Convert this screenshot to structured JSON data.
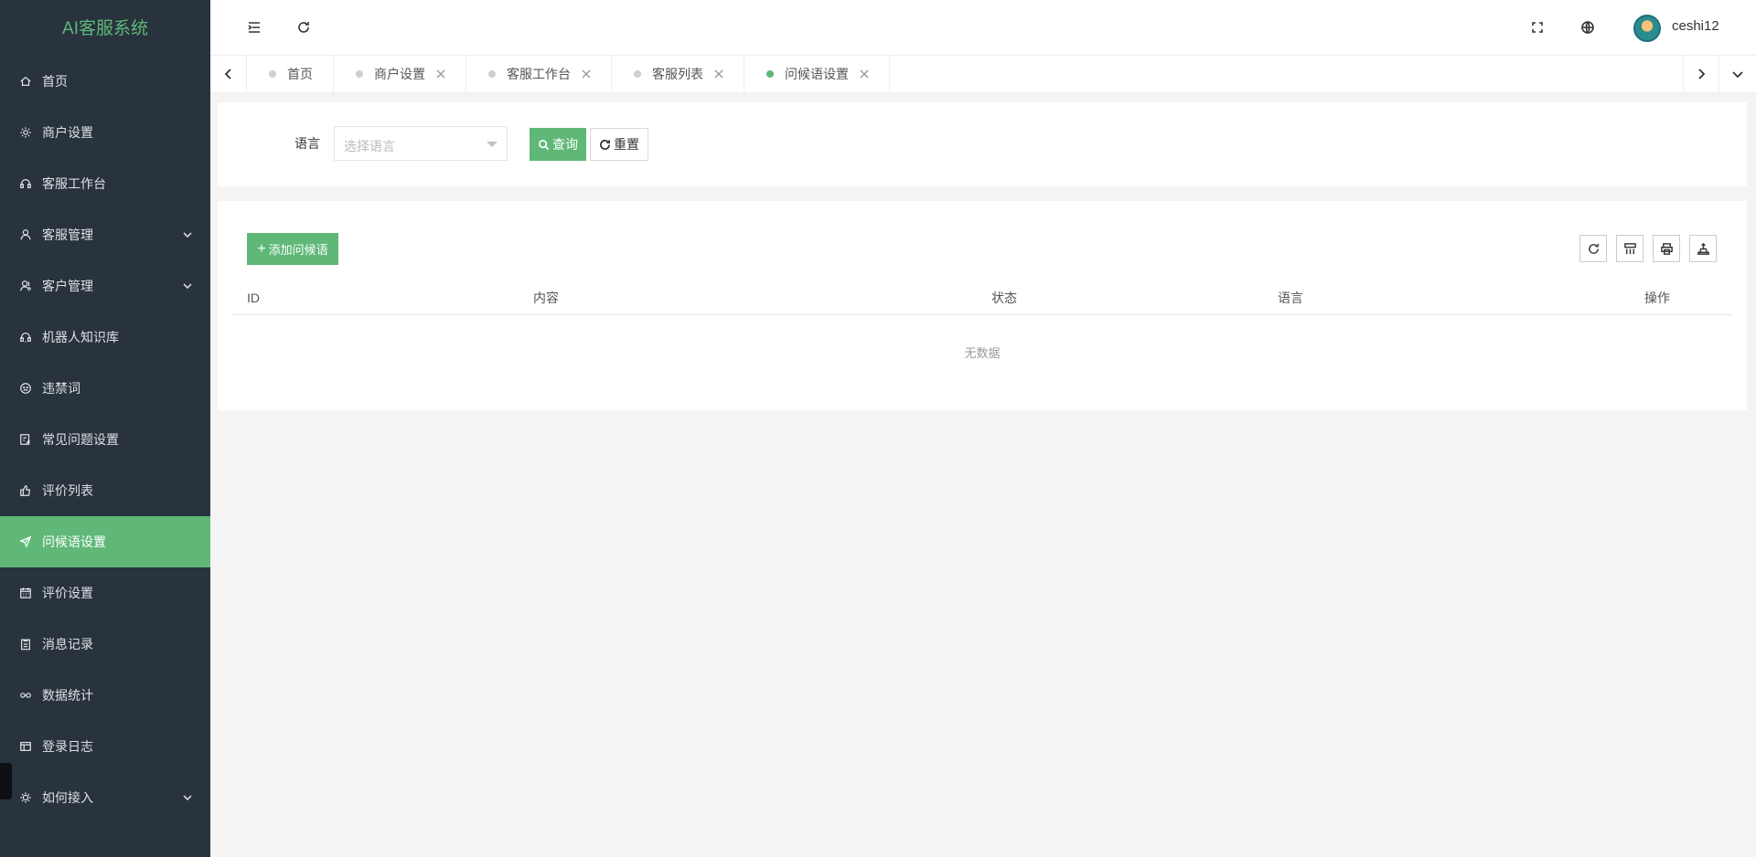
{
  "app": {
    "title": "AI客服系统"
  },
  "sidebar": {
    "items": [
      {
        "label": "首页",
        "icon": "home-icon"
      },
      {
        "label": "商户设置",
        "icon": "gear-icon"
      },
      {
        "label": "客服工作台",
        "icon": "headset-icon"
      },
      {
        "label": "客服管理",
        "icon": "user-icon",
        "expandable": true
      },
      {
        "label": "客户管理",
        "icon": "user-group-icon",
        "expandable": true
      },
      {
        "label": "机器人知识库",
        "icon": "robot-icon"
      },
      {
        "label": "违禁词",
        "icon": "face-icon"
      },
      {
        "label": "常见问题设置",
        "icon": "faq-icon"
      },
      {
        "label": "评价列表",
        "icon": "thumbs-up-icon"
      },
      {
        "label": "问候语设置",
        "icon": "send-icon",
        "active": true
      },
      {
        "label": "评价设置",
        "icon": "calendar-icon"
      },
      {
        "label": "消息记录",
        "icon": "clipboard-icon"
      },
      {
        "label": "数据统计",
        "icon": "link-icon"
      },
      {
        "label": "登录日志",
        "icon": "window-icon"
      },
      {
        "label": "如何接入",
        "icon": "plug-icon",
        "expandable": true
      }
    ]
  },
  "header": {
    "username": "ceshi12"
  },
  "tabs": [
    {
      "label": "首页",
      "closable": false
    },
    {
      "label": "商户设置",
      "closable": true
    },
    {
      "label": "客服工作台",
      "closable": true
    },
    {
      "label": "客服列表",
      "closable": true
    },
    {
      "label": "问候语设置",
      "closable": true,
      "active": true
    }
  ],
  "filter": {
    "language_label": "语言",
    "language_placeholder": "选择语言",
    "query_label": "查询",
    "reset_label": "重置"
  },
  "table": {
    "add_label": "添加问候语",
    "columns": [
      "ID",
      "内容",
      "状态",
      "语言",
      "操作"
    ],
    "empty_text": "无数据"
  },
  "colors": {
    "accent": "#5fb878",
    "sidebar_bg": "#28333e"
  }
}
